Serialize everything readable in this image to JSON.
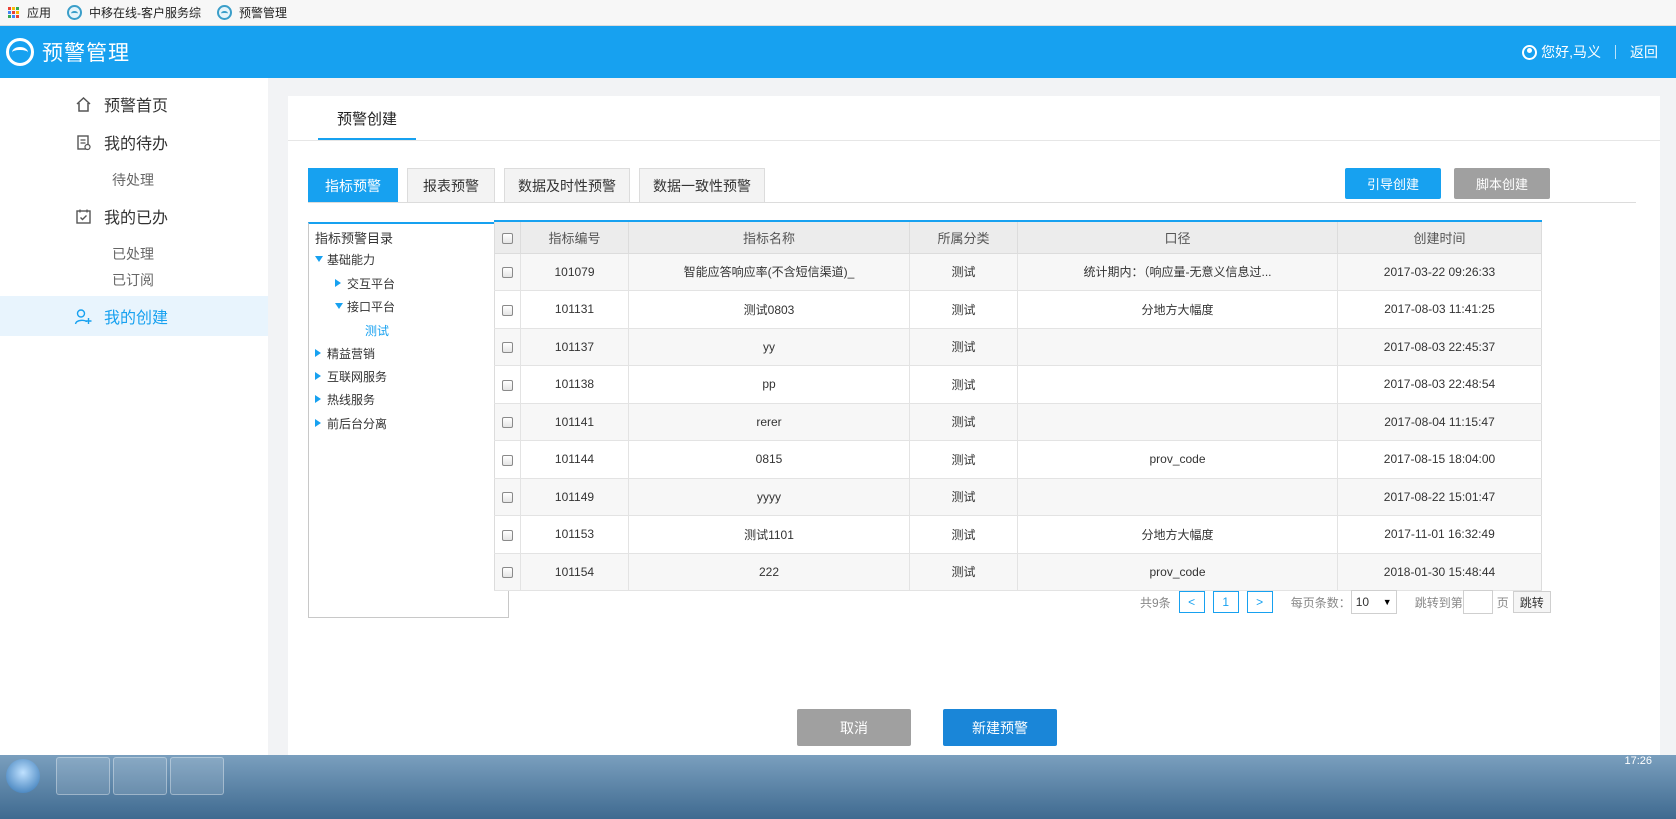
{
  "bookmarks": {
    "items": [
      {
        "label": "应用",
        "icon": "apps-grid-icon"
      },
      {
        "label": "中移在线-客户服务综",
        "icon": "globe-icon"
      },
      {
        "label": "预警管理",
        "icon": "globe-icon"
      }
    ]
  },
  "header": {
    "title": "预警管理",
    "greeting": "您好,马义",
    "back": "返回",
    "bg_color": "#17a1f0"
  },
  "sidebar": {
    "items": [
      {
        "label": "预警首页",
        "icon": "home-icon"
      },
      {
        "label": "我的待办",
        "icon": "document-icon"
      },
      {
        "label": "待处理"
      },
      {
        "label": "我的已办",
        "icon": "calendar-check-icon"
      },
      {
        "label": "已处理"
      },
      {
        "label": "已订阅"
      },
      {
        "label": "我的创建",
        "icon": "user-add-icon",
        "active": true
      }
    ]
  },
  "page": {
    "tab": "预警创建",
    "tabs": [
      {
        "label": "指标预警",
        "active": true
      },
      {
        "label": "报表预警"
      },
      {
        "label": "数据及时性预警"
      },
      {
        "label": "数据一致性预警"
      }
    ],
    "guide_button": "引导创建",
    "script_button": "脚本创建"
  },
  "tree": {
    "title": "指标预警目录",
    "nodes": [
      {
        "label": "基础能力",
        "expanded": true
      },
      {
        "label": "交互平台",
        "expanded": false
      },
      {
        "label": "接口平台",
        "expanded": true
      },
      {
        "label": "测试",
        "leaf": true
      },
      {
        "label": "精益营销",
        "expanded": false
      },
      {
        "label": "互联网服务",
        "expanded": false
      },
      {
        "label": "热线服务",
        "expanded": false
      },
      {
        "label": "前后台分离",
        "expanded": false
      }
    ]
  },
  "table": {
    "columns": [
      "指标编号",
      "指标名称",
      "所属分类",
      "口径",
      "创建时间"
    ],
    "rows": [
      [
        "101079",
        "智能应答响应率(不含短信渠道)_",
        "测试",
        "统计期内：（响应量-无意义信息过...",
        "2017-03-22 09:26:33"
      ],
      [
        "101131",
        "测试0803",
        "测试",
        "分地方大幅度",
        "2017-08-03 11:41:25"
      ],
      [
        "101137",
        "yy",
        "测试",
        "",
        "2017-08-03 22:45:37"
      ],
      [
        "101138",
        "pp",
        "测试",
        "",
        "2017-08-03 22:48:54"
      ],
      [
        "101141",
        "rerer",
        "测试",
        "",
        "2017-08-04 11:15:47"
      ],
      [
        "101144",
        "0815",
        "测试",
        "prov_code",
        "2017-08-15 18:04:00"
      ],
      [
        "101149",
        "yyyy",
        "测试",
        "",
        "2017-08-22 15:01:47"
      ],
      [
        "101153",
        "测试1101",
        "测试",
        "分地方大幅度",
        "2017-11-01 16:32:49"
      ],
      [
        "101154",
        "222",
        "测试",
        "prov_code",
        "2018-01-30 15:48:44"
      ]
    ]
  },
  "pagination": {
    "total": "共9条",
    "prev": "<",
    "current": "1",
    "next": ">",
    "per_page_label": "每页条数：",
    "per_page": "10",
    "jump_label": "跳转到第",
    "page_unit": "页",
    "go": "跳转"
  },
  "footer": {
    "cancel": "取消",
    "create": "新建预警"
  },
  "taskbar": {
    "clock": "17:26"
  }
}
